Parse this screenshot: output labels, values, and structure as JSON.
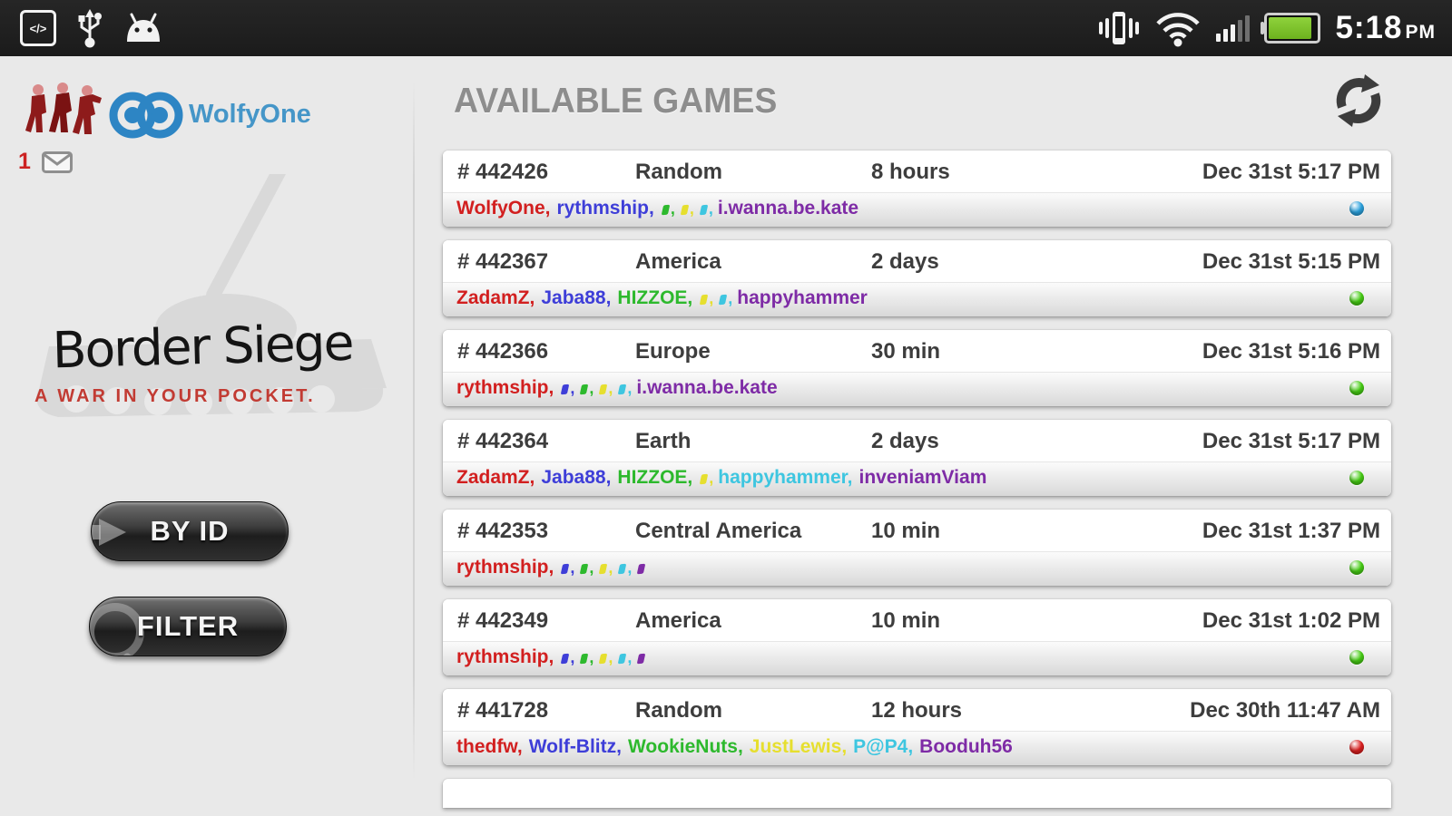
{
  "status_bar": {
    "time": "5:18",
    "meridiem": "PM",
    "left_icons": [
      "usb-debugging-icon",
      "usb-icon",
      "android-icon"
    ],
    "right_icons": [
      "vibrate-icon",
      "wifi-icon",
      "signal-strength-icon",
      "battery-icon"
    ]
  },
  "sidebar": {
    "user": {
      "name": "WolfyOne",
      "accent_color": "#4596c8"
    },
    "mail_count": "1",
    "logo_title": "Border Siege",
    "logo_tagline": "A WAR IN YOUR POCKET.",
    "tagline_color": "#c23b33",
    "buttons": [
      {
        "label": "BY ID"
      },
      {
        "label": "FILTER"
      }
    ]
  },
  "main": {
    "title": "AVAILABLE GAMES",
    "refresh_icon": "refresh-icon",
    "partial_row_visible": true,
    "games": [
      {
        "id": "# 442426",
        "map": "Random",
        "turn_time": "8 hours",
        "date": "Dec 31st 5:17 PM",
        "status_color": "#2ba3e0",
        "players": [
          {
            "name": "WolfyOne",
            "color": "#d21f1f"
          },
          {
            "name": "rythmship",
            "color": "#3e3ed8"
          },
          {
            "name": "",
            "color": "#2db92d"
          },
          {
            "name": "",
            "color": "#e6df2e"
          },
          {
            "name": "",
            "color": "#3ec6e0"
          },
          {
            "name": "i.wanna.be.kate",
            "color": "#7e2ba6"
          }
        ]
      },
      {
        "id": "# 442367",
        "map": "America",
        "turn_time": "2 days",
        "date": "Dec 31st 5:15 PM",
        "status_color": "#47cf14",
        "players": [
          {
            "name": "ZadamZ",
            "color": "#d21f1f"
          },
          {
            "name": "Jaba88",
            "color": "#3e3ed8"
          },
          {
            "name": "HIZZOE",
            "color": "#2db92d"
          },
          {
            "name": "",
            "color": "#e6df2e"
          },
          {
            "name": "",
            "color": "#3ec6e0"
          },
          {
            "name": "happyhammer",
            "color": "#7e2ba6"
          }
        ]
      },
      {
        "id": "# 442366",
        "map": "Europe",
        "turn_time": "30 min",
        "date": "Dec 31st 5:16 PM",
        "status_color": "#47cf14",
        "players": [
          {
            "name": "rythmship",
            "color": "#d21f1f"
          },
          {
            "name": "",
            "color": "#3e3ed8"
          },
          {
            "name": "",
            "color": "#2db92d"
          },
          {
            "name": "",
            "color": "#e6df2e"
          },
          {
            "name": "",
            "color": "#3ec6e0"
          },
          {
            "name": "i.wanna.be.kate",
            "color": "#7e2ba6"
          }
        ]
      },
      {
        "id": "# 442364",
        "map": "Earth",
        "turn_time": "2 days",
        "date": "Dec 31st 5:17 PM",
        "status_color": "#47cf14",
        "players": [
          {
            "name": "ZadamZ",
            "color": "#d21f1f"
          },
          {
            "name": "Jaba88",
            "color": "#3e3ed8"
          },
          {
            "name": "HIZZOE",
            "color": "#2db92d"
          },
          {
            "name": "",
            "color": "#e6df2e"
          },
          {
            "name": "happyhammer",
            "color": "#3ec6e0"
          },
          {
            "name": "inveniamViam",
            "color": "#7e2ba6"
          }
        ]
      },
      {
        "id": "# 442353",
        "map": "Central America",
        "turn_time": "10 min",
        "date": "Dec 31st 1:37 PM",
        "status_color": "#47cf14",
        "players": [
          {
            "name": "rythmship",
            "color": "#d21f1f"
          },
          {
            "name": "",
            "color": "#3e3ed8"
          },
          {
            "name": "",
            "color": "#2db92d"
          },
          {
            "name": "",
            "color": "#e6df2e"
          },
          {
            "name": "",
            "color": "#3ec6e0"
          },
          {
            "name": "",
            "color": "#7e2ba6"
          }
        ]
      },
      {
        "id": "# 442349",
        "map": "America",
        "turn_time": "10 min",
        "date": "Dec 31st 1:02 PM",
        "status_color": "#47cf14",
        "players": [
          {
            "name": "rythmship",
            "color": "#d21f1f"
          },
          {
            "name": "",
            "color": "#3e3ed8"
          },
          {
            "name": "",
            "color": "#2db92d"
          },
          {
            "name": "",
            "color": "#e6df2e"
          },
          {
            "name": "",
            "color": "#3ec6e0"
          },
          {
            "name": "",
            "color": "#7e2ba6"
          }
        ]
      },
      {
        "id": "# 441728",
        "map": "Random",
        "turn_time": "12 hours",
        "date": "Dec 30th 11:47 AM",
        "status_color": "#de2020",
        "players": [
          {
            "name": "thedfw",
            "color": "#d21f1f"
          },
          {
            "name": "Wolf-Blitz",
            "color": "#3e3ed8"
          },
          {
            "name": "WookieNuts",
            "color": "#2db92d"
          },
          {
            "name": "JustLewis",
            "color": "#e6df2e"
          },
          {
            "name": "P@P4",
            "color": "#3ec6e0"
          },
          {
            "name": "Booduh56",
            "color": "#7e2ba6"
          }
        ]
      }
    ]
  }
}
